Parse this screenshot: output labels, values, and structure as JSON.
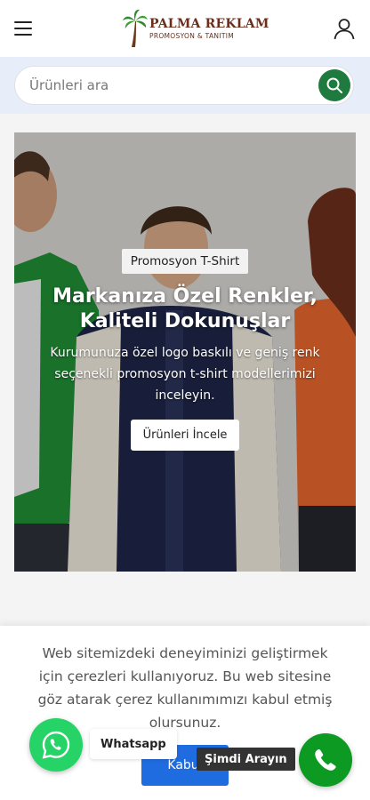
{
  "header": {
    "logo_name": "PALMA REKLAM",
    "logo_tagline": "PROMOSYON & TANITIM",
    "menu_icon": "hamburger-menu-icon",
    "account_icon": "user-icon"
  },
  "search": {
    "placeholder": "Ürünleri ara",
    "button_icon": "search-icon",
    "button_color": "#1f7a3f"
  },
  "hero": {
    "badge": "Promosyon T-Shirt",
    "title": "Markanıza Özel Renkler, Kaliteli Dokunuşlar",
    "description": "Kurumunuza özel logo baskılı ve geniş renk seçenekli promosyon t-shirt modellerimizi inceleyin.",
    "cta_label": "Ürünleri İncele"
  },
  "cookie": {
    "message": "Web sitemizdeki deneyiminizi geliştirmek için çerezleri kullanıyoruz. Bu web sitesine göz atarak çerez kullanımımızı kabul etmiş olursunuz.",
    "accept_label": "Kabul",
    "accept_color": "#1f6ce0"
  },
  "floating": {
    "whatsapp_label": "Whatsapp",
    "whatsapp_icon": "whatsapp-icon",
    "whatsapp_color": "#25d366",
    "call_label": "Şimdi Arayın",
    "call_icon": "phone-icon",
    "call_color": "#0c9a22"
  }
}
